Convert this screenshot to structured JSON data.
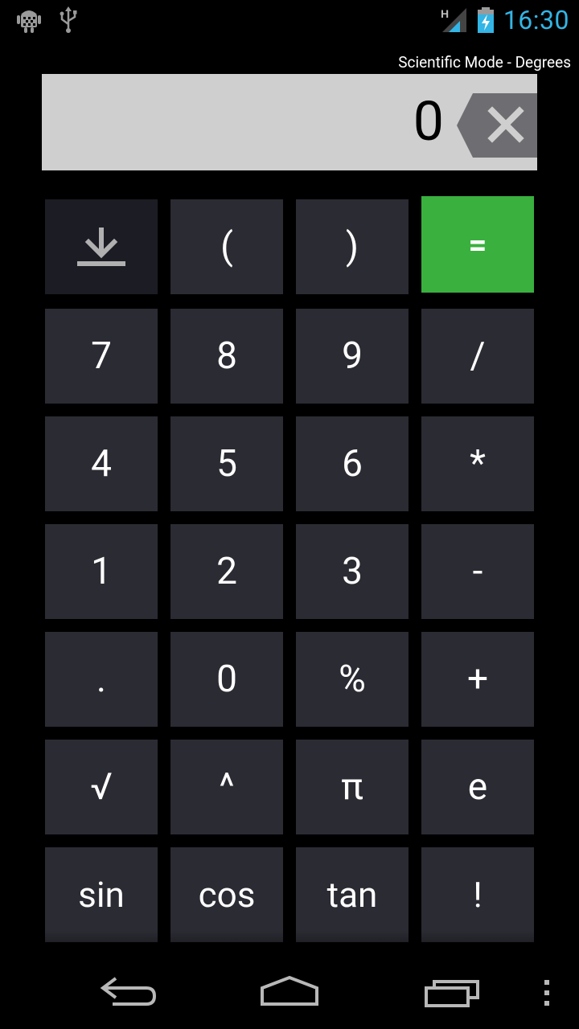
{
  "status_bar": {
    "clock": "16:30",
    "network_type": "H",
    "icons": [
      "android-debug-icon",
      "usb-icon",
      "signal-icon",
      "battery-charging-icon"
    ],
    "clock_color": "#33b5e5"
  },
  "mode_label": "Scientific Mode - Degrees",
  "display": {
    "value": "0",
    "background": "#cfcfcf"
  },
  "keypad": {
    "rows": [
      [
        "save",
        "(",
        ")",
        "="
      ],
      [
        "7",
        "8",
        "9",
        "/"
      ],
      [
        "4",
        "5",
        "6",
        "*"
      ],
      [
        "1",
        "2",
        "3",
        "-"
      ],
      [
        ".",
        "0",
        "%",
        "+"
      ],
      [
        "√",
        "^",
        "π",
        "e"
      ],
      [
        "sin",
        "cos",
        "tan",
        "!"
      ]
    ],
    "key_color": "#2b2b33",
    "equals_color": "#3ab03f"
  },
  "nav_bar": {
    "icons": [
      "back-icon",
      "home-icon",
      "recent-apps-icon",
      "overflow-menu-icon"
    ]
  }
}
